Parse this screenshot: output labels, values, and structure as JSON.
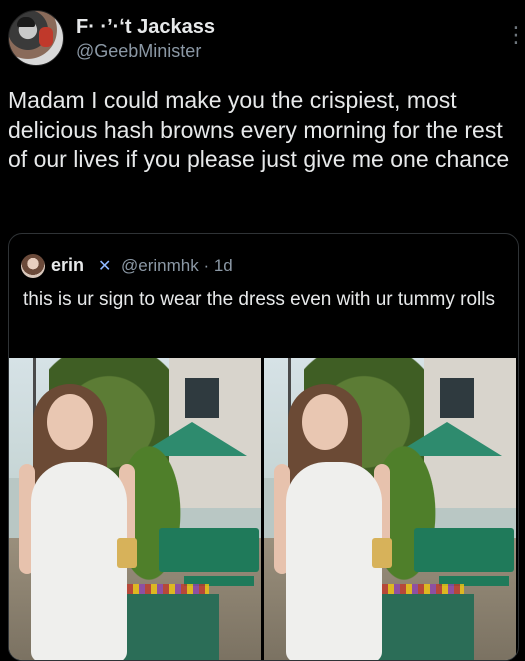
{
  "tweet": {
    "display_name": "F· ·’·ʻt Jackass",
    "handle": "@GeebMinister",
    "text": "Madam I could make you the crispiest, most delicious hash browns every morning for the rest of our lives if you please just give me one chance",
    "more_icon": "more-vertical-icon"
  },
  "quoted_tweet": {
    "display_name": "erin",
    "badge_icon": "butterfly-icon",
    "handle_time": "@erinmhk · 1d",
    "text": "this is ur sign to wear the dress even with ur tummy rolls",
    "media_count": 2
  },
  "colors": {
    "background": "#000000",
    "text": "#e7e9ea",
    "secondary_text": "#8b98a5",
    "border": "#2f3336"
  }
}
